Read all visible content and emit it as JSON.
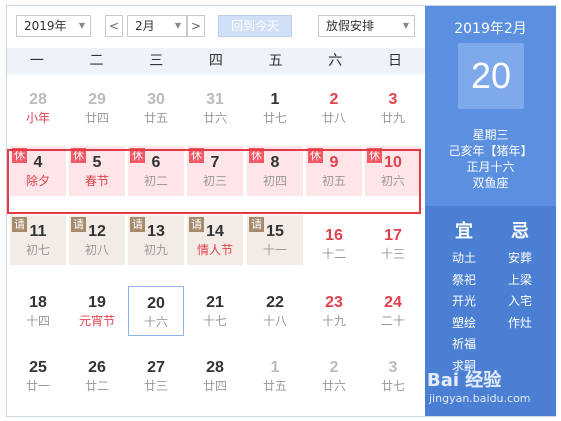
{
  "toolbar": {
    "year": "2019年",
    "prev": "<",
    "month": "2月",
    "next": ">",
    "today_label": "回到今天",
    "holiday_select": "放假安排"
  },
  "weekdays": [
    "一",
    "二",
    "三",
    "四",
    "五",
    "六",
    "日"
  ],
  "weeks": [
    [
      {
        "day": "28",
        "sub": "小年",
        "other": true,
        "sub_red": true
      },
      {
        "day": "29",
        "sub": "廿四",
        "other": true
      },
      {
        "day": "30",
        "sub": "廿五",
        "other": true
      },
      {
        "day": "31",
        "sub": "廿六",
        "other": true
      },
      {
        "day": "1",
        "sub": "廿七"
      },
      {
        "day": "2",
        "sub": "廿八",
        "weekend": true
      },
      {
        "day": "3",
        "sub": "廿九",
        "weekend": true
      }
    ],
    [
      {
        "day": "4",
        "sub": "除夕",
        "tag": "休",
        "holiday": true,
        "sub_red": true
      },
      {
        "day": "5",
        "sub": "春节",
        "tag": "休",
        "holiday": true,
        "sub_red": true
      },
      {
        "day": "6",
        "sub": "初二",
        "tag": "休",
        "holiday": true
      },
      {
        "day": "7",
        "sub": "初三",
        "tag": "休",
        "holiday": true
      },
      {
        "day": "8",
        "sub": "初四",
        "tag": "休",
        "holiday": true
      },
      {
        "day": "9",
        "sub": "初五",
        "tag": "休",
        "holiday": true,
        "weekend": true
      },
      {
        "day": "10",
        "sub": "初六",
        "tag": "休",
        "holiday": true,
        "weekend": true
      }
    ],
    [
      {
        "day": "11",
        "sub": "初七",
        "tag": "请",
        "workday": true
      },
      {
        "day": "12",
        "sub": "初八",
        "tag": "请",
        "workday": true
      },
      {
        "day": "13",
        "sub": "初九",
        "tag": "请",
        "workday": true
      },
      {
        "day": "14",
        "sub": "情人节",
        "tag": "请",
        "workday": true,
        "sub_red": true
      },
      {
        "day": "15",
        "sub": "十一",
        "tag": "请",
        "workday": true
      },
      {
        "day": "16",
        "sub": "十二",
        "weekend": true
      },
      {
        "day": "17",
        "sub": "十三",
        "weekend": true
      }
    ],
    [
      {
        "day": "18",
        "sub": "十四"
      },
      {
        "day": "19",
        "sub": "元宵节",
        "sub_red": true
      },
      {
        "day": "20",
        "sub": "十六",
        "today": true
      },
      {
        "day": "21",
        "sub": "十七"
      },
      {
        "day": "22",
        "sub": "十八"
      },
      {
        "day": "23",
        "sub": "十九",
        "weekend": true
      },
      {
        "day": "24",
        "sub": "二十",
        "weekend": true
      }
    ],
    [
      {
        "day": "25",
        "sub": "廿一"
      },
      {
        "day": "26",
        "sub": "廿二"
      },
      {
        "day": "27",
        "sub": "廿三"
      },
      {
        "day": "28",
        "sub": "廿四"
      },
      {
        "day": "1",
        "sub": "廿五",
        "other": true
      },
      {
        "day": "2",
        "sub": "廿六",
        "other": true
      },
      {
        "day": "3",
        "sub": "廿七",
        "other": true
      }
    ]
  ],
  "panel": {
    "year_month": "2019年2月",
    "day": "20",
    "weekday": "星期三",
    "ganzhi": "己亥年【猪年】",
    "lunar": "正月十六",
    "zodiac": "双鱼座",
    "yi_label": "宜",
    "ji_label": "忌",
    "yi": [
      "动土",
      "祭祀",
      "开光",
      "塑绘",
      "祈福",
      "求嗣"
    ],
    "ji": [
      "安葬",
      "上梁",
      "入宅",
      "作灶"
    ]
  },
  "watermark": {
    "brand": "Bai 经验",
    "url": "jingyan.baidu.com"
  },
  "colors": {
    "accent": "#5b8fe0",
    "holiday_bg": "#fde5e8",
    "workday_bg": "#f3ebe5",
    "red": "#e0424d",
    "highlight_border": "#e53946"
  }
}
